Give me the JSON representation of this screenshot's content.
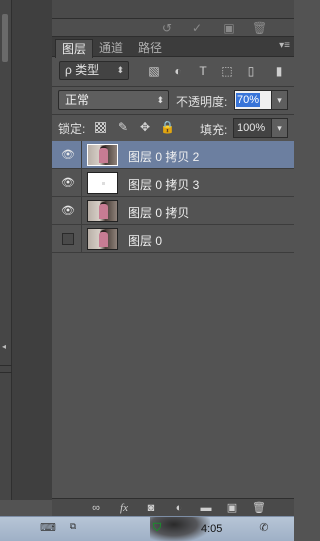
{
  "tabs": [
    {
      "label": "图层",
      "active": true
    },
    {
      "label": "通道",
      "active": false
    },
    {
      "label": "路径",
      "active": false
    }
  ],
  "filter": {
    "label": "ρ 类型"
  },
  "blend_mode": {
    "value": "正常"
  },
  "opacity": {
    "label": "不透明度:",
    "value": "70%"
  },
  "lock": {
    "label": "锁定:"
  },
  "fill": {
    "label": "填充:",
    "value": "100%"
  },
  "layers": [
    {
      "name": "图层 0 拷贝 2",
      "visible": true,
      "selected": true,
      "thumb": "photo"
    },
    {
      "name": "图层 0 拷贝 3",
      "visible": true,
      "selected": false,
      "thumb": "white"
    },
    {
      "name": "图层 0 拷贝",
      "visible": true,
      "selected": false,
      "thumb": "photo"
    },
    {
      "name": "图层 0",
      "visible": false,
      "selected": false,
      "thumb": "photo"
    }
  ],
  "bottom_icons": [
    "link-icon",
    "fx-icon",
    "mask-icon",
    "adjustment-icon",
    "folder-icon",
    "new-layer-icon",
    "trash-icon"
  ],
  "taskbar": {
    "time": "4:05"
  },
  "colors": {
    "panel_bg": "#535353",
    "selected_layer": "#6c7fa0",
    "opacity_highlight": "#3874d8"
  }
}
